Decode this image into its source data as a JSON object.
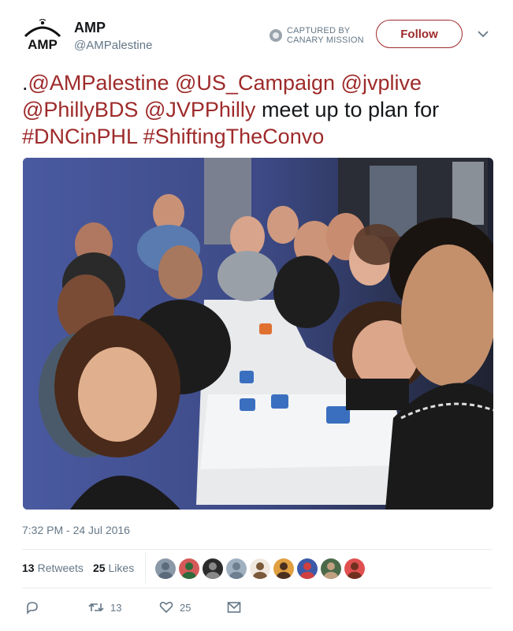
{
  "account": {
    "name": "AMP",
    "handle": "@AMPalestine",
    "logo_text": "AMP"
  },
  "captured": {
    "line1": "CAPTURED BY",
    "line2": "CANARY MISSION",
    "icon": "canary-mission-icon"
  },
  "follow_button": {
    "label": "Follow"
  },
  "tweet": {
    "prefix": ".",
    "mentions": [
      "@AMPalestine",
      "@US_Campaign",
      "@jvplive",
      "@PhillyBDS",
      "@JVPPhilly"
    ],
    "text": "meet up to plan for",
    "hashtags": [
      "#DNCinPHL",
      "#ShiftingTheConvo"
    ]
  },
  "timestamp": "7:32 PM - 24 Jul 2016",
  "stats": {
    "retweets_count": "13",
    "retweets_label": "Retweets",
    "likes_count": "25",
    "likes_label": "Likes"
  },
  "liker_avatars": [
    {
      "bg": "#8a98a8",
      "fg": "#5b6b7b"
    },
    {
      "bg": "#d45a5a",
      "fg": "#2e6b3a"
    },
    {
      "bg": "#2b2b2b",
      "fg": "#888"
    },
    {
      "bg": "#9fb0c0",
      "fg": "#6d7f90"
    },
    {
      "bg": "#efe9e0",
      "fg": "#7a5a3a"
    },
    {
      "bg": "#e0a040",
      "fg": "#4a3020"
    },
    {
      "bg": "#3c5aa8",
      "fg": "#d04040"
    },
    {
      "bg": "#4a6a4a",
      "fg": "#c0a080"
    },
    {
      "bg": "#e05050",
      "fg": "#703020"
    }
  ],
  "actions": {
    "reply_icon": "reply-icon",
    "retweet_icon": "retweet-icon",
    "retweet_count": "13",
    "like_icon": "heart-icon",
    "like_count": "25",
    "dm_icon": "envelope-icon"
  },
  "colors": {
    "link": "#9e2a2a",
    "muted": "#657786"
  }
}
